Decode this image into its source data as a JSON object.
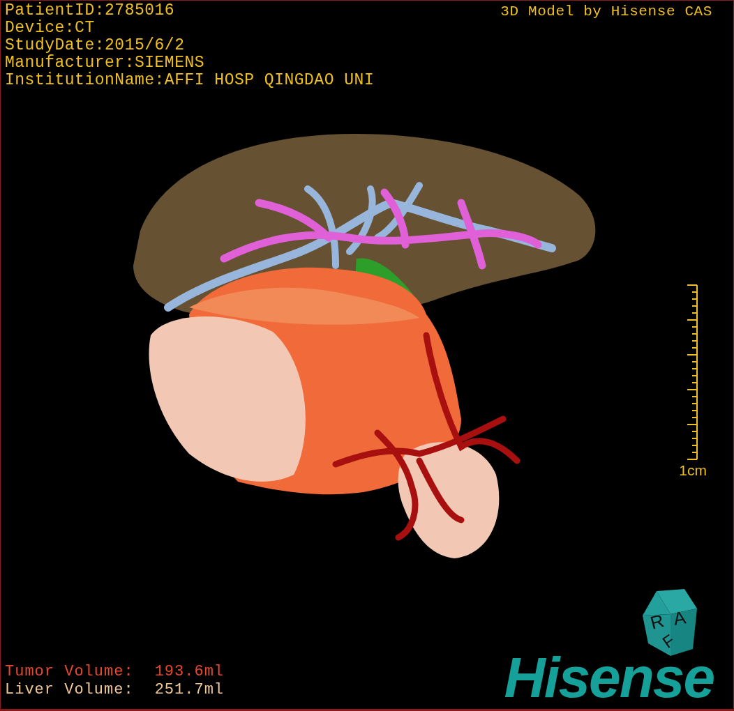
{
  "patient_info": [
    "PatientID:2785016",
    "Device:CT",
    "StudyDate:2015/6/2",
    "Manufacturer:SIEMENS",
    "InstitutionName:AFFI HOSP QINGDAO UNI"
  ],
  "credit": "3D Model by Hisense CAS",
  "scale_bar": {
    "label": "1cm"
  },
  "orientation_cube": {
    "faces": [
      {
        "label": "R"
      },
      {
        "label": "A"
      },
      {
        "label": "F"
      }
    ]
  },
  "volumes": [
    {
      "label": "Tumor Volume:",
      "value": "193.6ml",
      "color": "#e8482c"
    },
    {
      "label": "Liver Volume:",
      "value": "251.7ml",
      "color": "#f0c896"
    }
  ],
  "logo": "Hisense"
}
